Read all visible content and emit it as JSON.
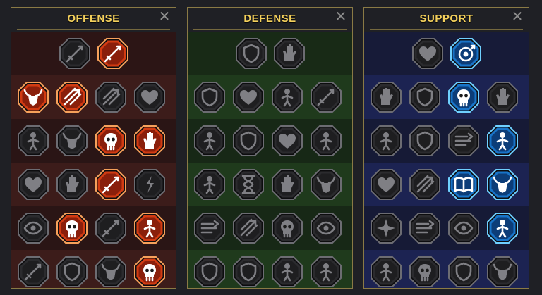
{
  "colors": {
    "title": "#f3d05c",
    "panel_border": "#8a7a45",
    "inactive_fill": "#2b2b2e",
    "inactive_rim": "#6c6c72",
    "inactive_glyph": "#7f7f84",
    "offense_active_fill": "#d23b12",
    "offense_active_rim": "#f6a15b",
    "support_active_fill": "#1874c8",
    "support_active_rim": "#6fd0ff",
    "active_glyph": "#ffffff"
  },
  "panels": [
    {
      "key": "offense",
      "title": "OFFENSE",
      "close_glyph": "✕",
      "active_theme": "offense",
      "rows": [
        [
          {
            "icon": "crossed-swords-icon",
            "active": false
          },
          {
            "icon": "flaming-blade-icon",
            "active": true
          }
        ],
        [
          {
            "icon": "demon-horns-icon",
            "active": true
          },
          {
            "icon": "arrow-volley-icon",
            "active": true
          },
          {
            "icon": "shield-arrow-icon",
            "active": false
          },
          {
            "icon": "heart-sword-icon",
            "active": false
          }
        ],
        [
          {
            "icon": "charging-warrior-icon",
            "active": false
          },
          {
            "icon": "fanged-jaw-icon",
            "active": false
          },
          {
            "icon": "skull-strike-icon",
            "active": true
          },
          {
            "icon": "fist-strike-icon",
            "active": true
          }
        ],
        [
          {
            "icon": "heart-dagger-icon",
            "active": false
          },
          {
            "icon": "armored-fist-icon",
            "active": false
          },
          {
            "icon": "axe-blow-icon",
            "active": true
          },
          {
            "icon": "chain-lightning-icon",
            "active": false
          }
        ],
        [
          {
            "icon": "cyclops-eye-icon",
            "active": false
          },
          {
            "icon": "twin-skulls-icon",
            "active": true
          },
          {
            "icon": "dagger-icon",
            "active": false
          },
          {
            "icon": "enraged-warrior-icon",
            "active": true
          }
        ],
        [
          {
            "icon": "sword-slash-icon",
            "active": false
          },
          {
            "icon": "knight-helm-icon",
            "active": false
          },
          {
            "icon": "beast-icon",
            "active": false
          },
          {
            "icon": "flaming-skull-icon",
            "active": true
          }
        ]
      ]
    },
    {
      "key": "defense",
      "title": "DEFENSE",
      "close_glyph": "✕",
      "active_theme": "defense",
      "rows": [
        [
          {
            "icon": "stone-wall-icon",
            "active": false
          },
          {
            "icon": "raised-fist-icon",
            "active": false
          }
        ],
        [
          {
            "icon": "layered-shield-icon",
            "active": false
          },
          {
            "icon": "armored-heart-icon",
            "active": false
          },
          {
            "icon": "muscled-torso-icon",
            "active": false
          },
          {
            "icon": "deflect-blade-icon",
            "active": false
          }
        ],
        [
          {
            "icon": "deflecting-fighter-icon",
            "active": false
          },
          {
            "icon": "shield-bearer-icon",
            "active": false
          },
          {
            "icon": "heart-shield-icon",
            "active": false
          },
          {
            "icon": "hooded-head-icon",
            "active": false
          }
        ],
        [
          {
            "icon": "crowd-icon",
            "active": false
          },
          {
            "icon": "hourglass-icon",
            "active": false
          },
          {
            "icon": "open-palm-icon",
            "active": false
          },
          {
            "icon": "bull-head-icon",
            "active": false
          }
        ],
        [
          {
            "icon": "running-man-icon",
            "active": false
          },
          {
            "icon": "claw-marks-icon",
            "active": false
          },
          {
            "icon": "spiked-skull-icon",
            "active": false
          },
          {
            "icon": "crossed-out-eye-icon",
            "active": false
          }
        ],
        [
          {
            "icon": "horned-helm-icon",
            "active": false
          },
          {
            "icon": "tower-shield-icon",
            "active": false
          },
          {
            "icon": "skeleton-icon",
            "active": false
          },
          {
            "icon": "brute-icon",
            "active": false
          }
        ]
      ]
    },
    {
      "key": "support",
      "title": "SUPPORT",
      "close_glyph": "✕",
      "active_theme": "support",
      "rows": [
        [
          {
            "icon": "heart-sparkle-icon",
            "active": false
          },
          {
            "icon": "target-wings-icon",
            "active": true
          }
        ],
        [
          {
            "icon": "praying-hands-icon",
            "active": false
          },
          {
            "icon": "shield-ring-icon",
            "active": false
          },
          {
            "icon": "flaming-skull-icon",
            "active": true
          },
          {
            "icon": "speed-hand-icon",
            "active": false
          }
        ],
        [
          {
            "icon": "blessed-figure-icon",
            "active": false
          },
          {
            "icon": "lightning-shield-icon",
            "active": false
          },
          {
            "icon": "wind-swirl-icon",
            "active": false
          },
          {
            "icon": "twin-figures-icon",
            "active": true
          }
        ],
        [
          {
            "icon": "chained-heart-icon",
            "active": false
          },
          {
            "icon": "meteor-icon",
            "active": false
          },
          {
            "icon": "open-book-icon",
            "active": true
          },
          {
            "icon": "angry-face-icon",
            "active": true
          }
        ],
        [
          {
            "icon": "compass-star-icon",
            "active": false
          },
          {
            "icon": "swift-boot-icon",
            "active": false
          },
          {
            "icon": "all-seeing-eye-icon",
            "active": false
          },
          {
            "icon": "dodging-figure-icon",
            "active": true
          }
        ],
        [
          {
            "icon": "poison-flask-icon",
            "active": false
          },
          {
            "icon": "skull-icon",
            "active": false
          },
          {
            "icon": "fortress-icon",
            "active": false
          },
          {
            "icon": "eagle-head-icon",
            "active": false
          }
        ]
      ]
    }
  ]
}
